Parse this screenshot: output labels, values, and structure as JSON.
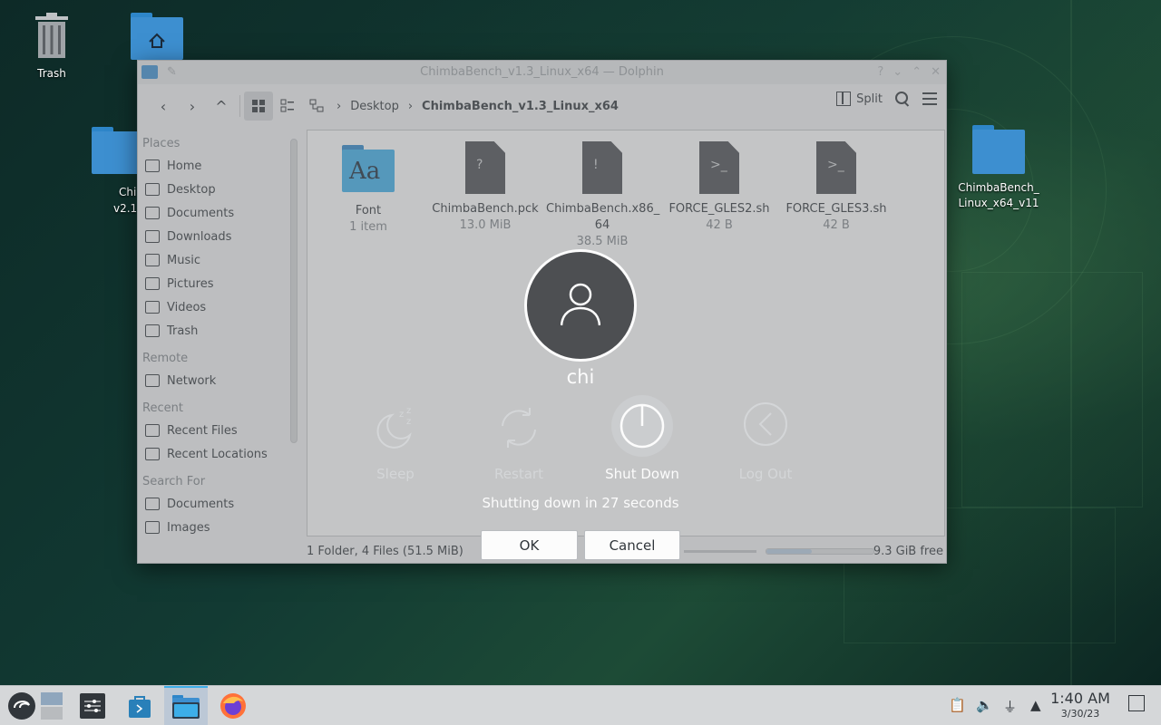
{
  "desktop": {
    "icons": [
      {
        "label": "Trash"
      },
      {
        "label": "Chi"
      },
      {
        "label": "v2.1"
      },
      {
        "label": "ChimbaBench_"
      },
      {
        "label": "Linux_x64_v11"
      }
    ]
  },
  "window": {
    "title": "ChimbaBench_v1.3_Linux_x64 — Dolphin",
    "breadcrumb": [
      "Desktop",
      "ChimbaBench_v1.3_Linux_x64"
    ],
    "toolbar": {
      "split_label": "Split"
    },
    "sidebar": {
      "sections": [
        {
          "title": "Places",
          "items": [
            "Home",
            "Desktop",
            "Documents",
            "Downloads",
            "Music",
            "Pictures",
            "Videos",
            "Trash"
          ]
        },
        {
          "title": "Remote",
          "items": [
            "Network"
          ]
        },
        {
          "title": "Recent",
          "items": [
            "Recent Files",
            "Recent Locations"
          ]
        },
        {
          "title": "Search For",
          "items": [
            "Documents",
            "Images"
          ]
        }
      ]
    },
    "files": [
      {
        "name": "Font",
        "size": "1 item",
        "kind": "folder",
        "glyph": "Aa"
      },
      {
        "name": "ChimbaBench.pck",
        "size": "13.0 MiB",
        "kind": "file",
        "glyph": "?"
      },
      {
        "name": "ChimbaBench.x86_",
        "name2": "64",
        "size": "38.5 MiB",
        "kind": "file",
        "glyph": "!"
      },
      {
        "name": "FORCE_GLES2.sh",
        "size": "42 B",
        "kind": "script",
        "glyph": ">_"
      },
      {
        "name": "FORCE_GLES3.sh",
        "size": "42 B",
        "kind": "script",
        "glyph": ">_"
      }
    ],
    "status": {
      "summary": "1 Folder, 4 Files (51.5 MiB)",
      "free": "9.3 GiB free",
      "used_fraction": 0.42
    }
  },
  "logout_dialog": {
    "username": "chi",
    "actions": [
      {
        "label": "Sleep",
        "active": false
      },
      {
        "label": "Restart",
        "active": false
      },
      {
        "label": "Shut Down",
        "active": true
      },
      {
        "label": "Log Out",
        "active": false
      }
    ],
    "countdown": "Shutting down in 27 seconds",
    "ok_label": "OK",
    "cancel_label": "Cancel"
  },
  "taskbar": {
    "time": "1:40 AM",
    "date": "3/30/23"
  },
  "colors": {
    "accent": "#3daee9",
    "folder": "#3daee9",
    "text": "#31363b"
  }
}
